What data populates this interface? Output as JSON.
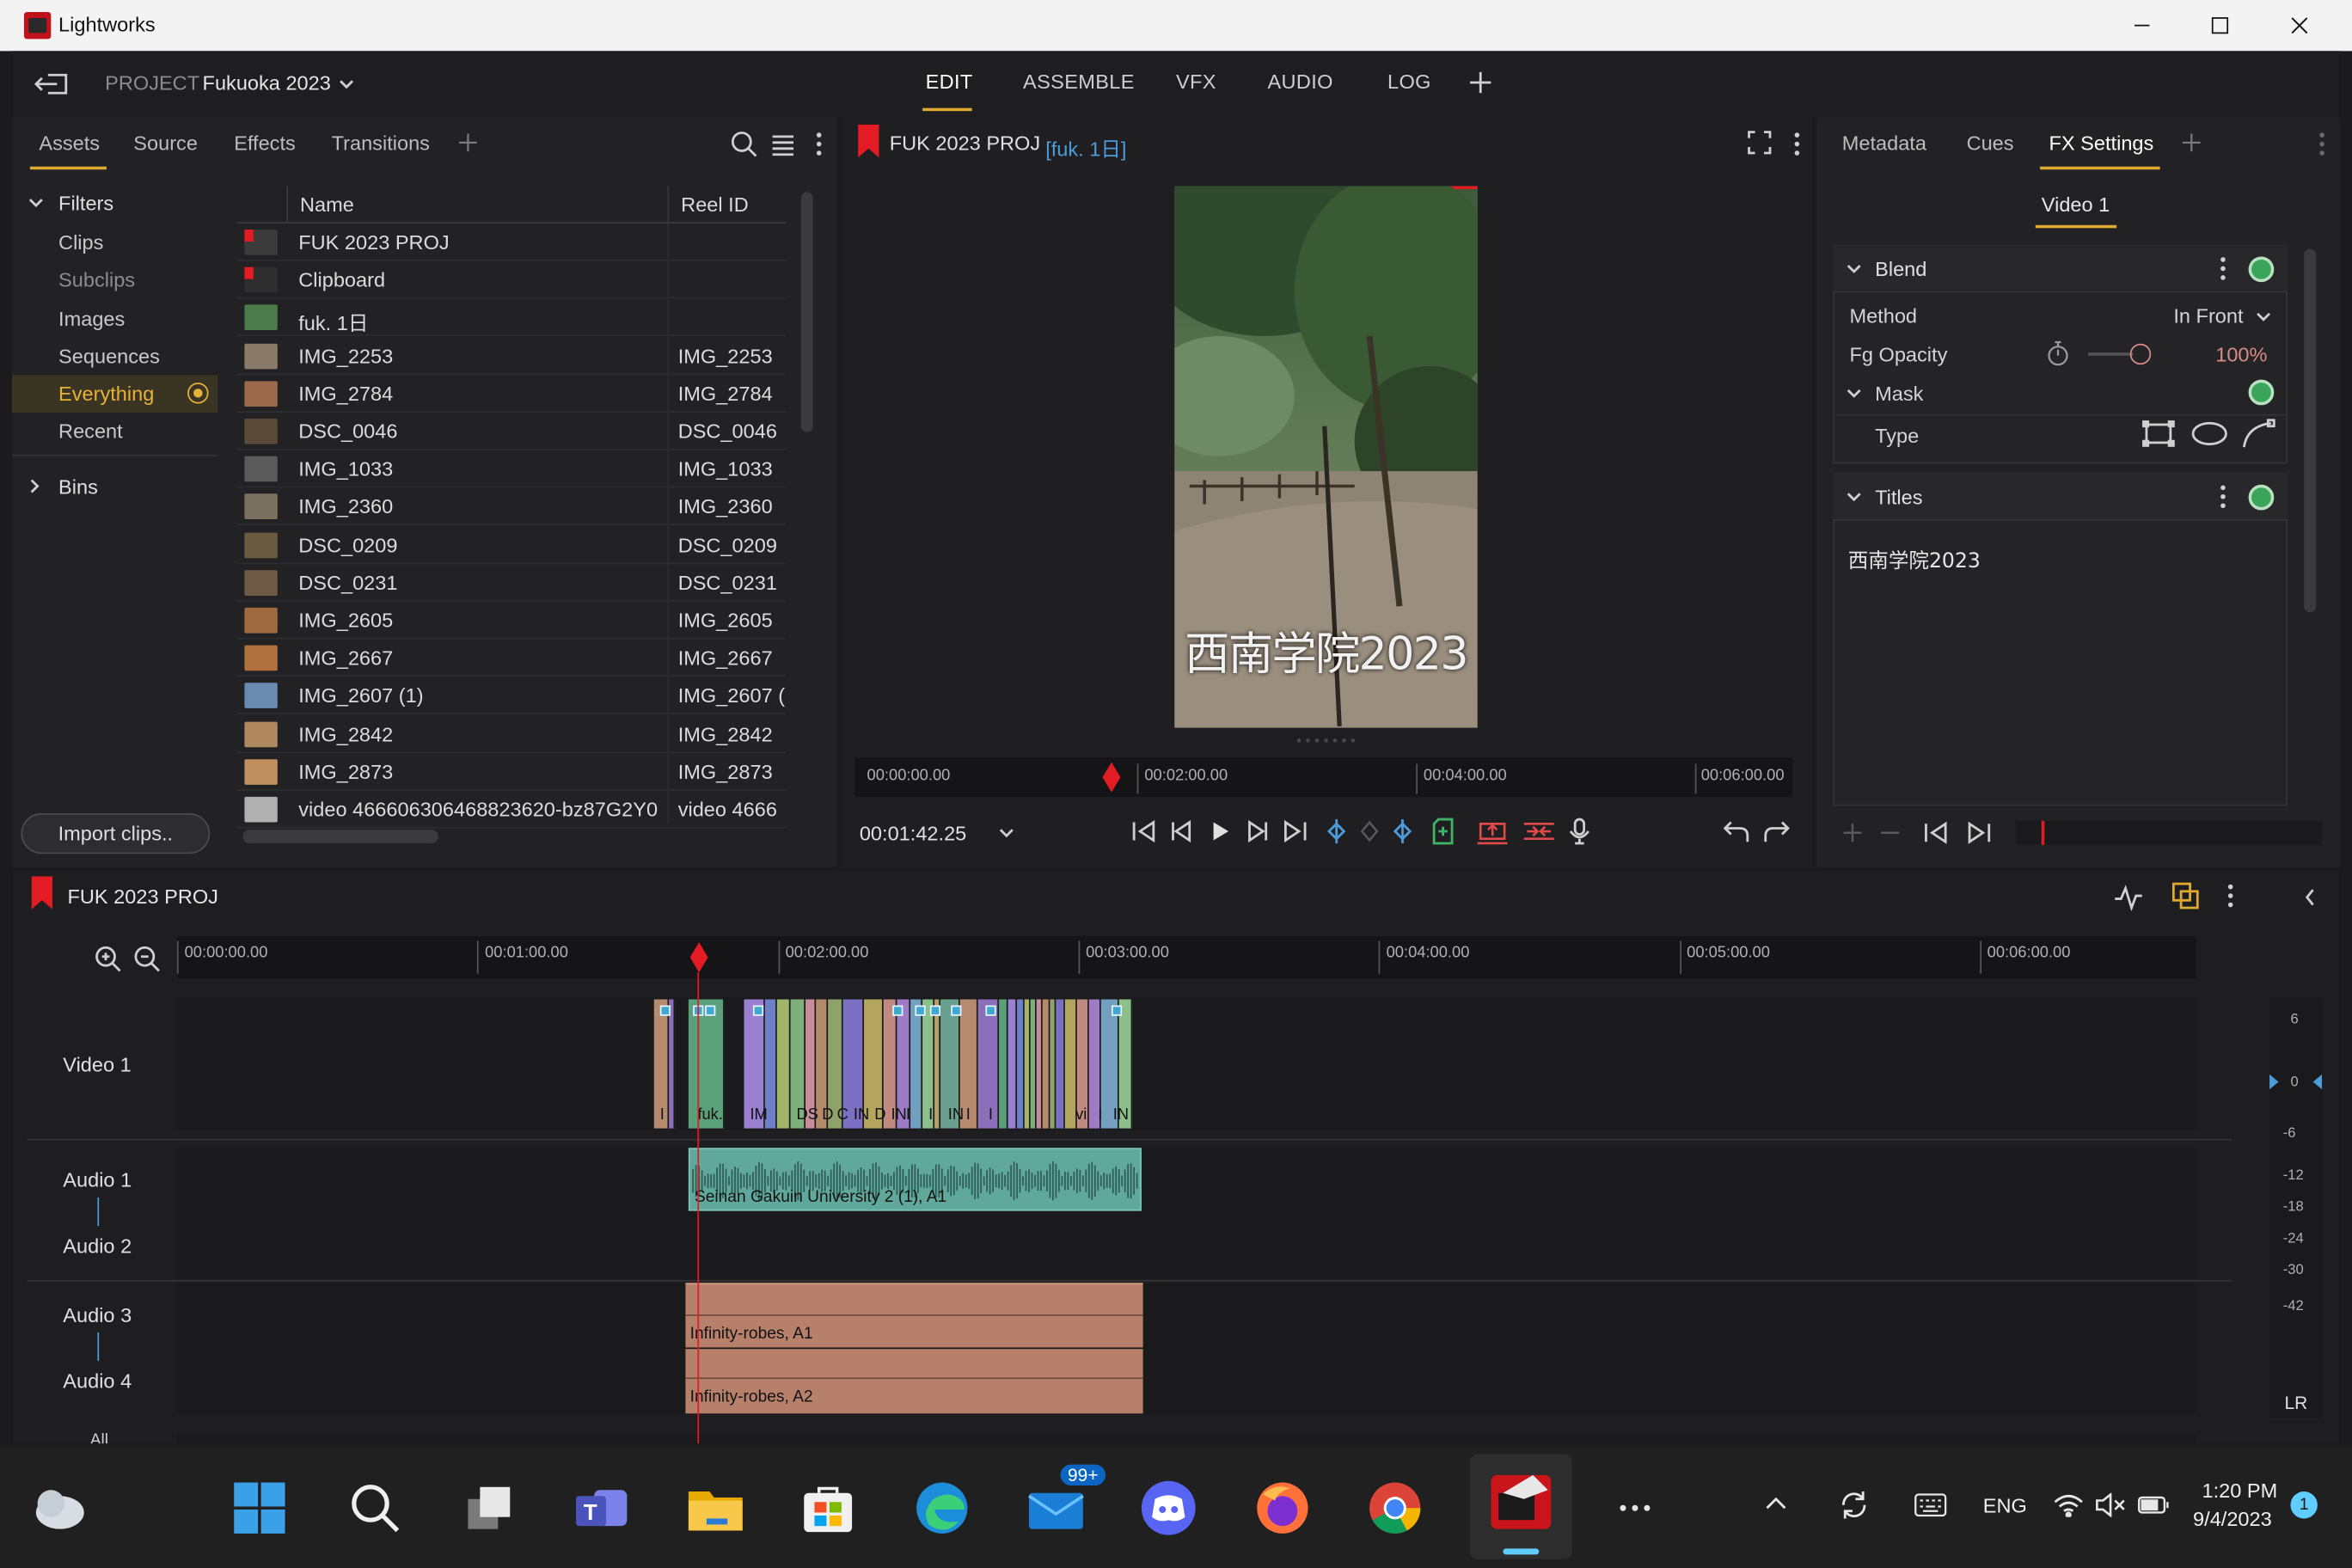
{
  "window": {
    "title": "Lightworks"
  },
  "topnav": {
    "project_prefix": "PROJECT",
    "project_name": "Fukuoka 2023",
    "tabs": [
      "EDIT",
      "ASSEMBLE",
      "VFX",
      "AUDIO",
      "LOG"
    ],
    "active_tab": "EDIT"
  },
  "assets_panel": {
    "tabs": [
      "Assets",
      "Source",
      "Effects",
      "Transitions"
    ],
    "active_tab": "Assets",
    "filters_header": "Filters",
    "filters": [
      "Clips",
      "Subclips",
      "Images",
      "Sequences",
      "Everything",
      "Recent"
    ],
    "active_filter": "Everything",
    "bins_header": "Bins",
    "import_button": "Import clips..",
    "columns": [
      "Name",
      "Reel ID"
    ],
    "rows": [
      {
        "name": "FUK 2023 PROJ",
        "reel": ""
      },
      {
        "name": "Clipboard",
        "reel": ""
      },
      {
        "name": "fuk. 1日",
        "reel": ""
      },
      {
        "name": "IMG_2253",
        "reel": "IMG_2253"
      },
      {
        "name": "IMG_2784",
        "reel": "IMG_2784"
      },
      {
        "name": "DSC_0046",
        "reel": "DSC_0046"
      },
      {
        "name": "IMG_1033",
        "reel": "IMG_1033"
      },
      {
        "name": "IMG_2360",
        "reel": "IMG_2360"
      },
      {
        "name": "DSC_0209",
        "reel": "DSC_0209"
      },
      {
        "name": "DSC_0231",
        "reel": "DSC_0231"
      },
      {
        "name": "IMG_2605",
        "reel": "IMG_2605"
      },
      {
        "name": "IMG_2667",
        "reel": "IMG_2667"
      },
      {
        "name": "IMG_2607 (1)",
        "reel": "IMG_2607 ("
      },
      {
        "name": "IMG_2842",
        "reel": "IMG_2842"
      },
      {
        "name": "IMG_2873",
        "reel": "IMG_2873"
      },
      {
        "name": "video 466606306468823620-bz87G2Y0",
        "reel": "video 4666"
      }
    ]
  },
  "viewer": {
    "title": "FUK 2023 PROJ",
    "subtitle": "[fuk. 1日]",
    "overlay_text": "西南学院2023",
    "ruler": [
      "00:00:00.00",
      "00:02:00.00",
      "00:04:00.00",
      "00:06:00.00"
    ],
    "timecode": "00:01:42.25",
    "playhead_fraction": 0.284
  },
  "fx_panel": {
    "tabs": [
      "Metadata",
      "Cues",
      "FX Settings"
    ],
    "active_tab": "FX Settings",
    "subtab": "Video 1",
    "blend_label": "Blend",
    "method_label": "Method",
    "method_value": "In Front",
    "opacity_label": "Fg Opacity",
    "opacity_value": "100%",
    "mask_label": "Mask",
    "type_label": "Type",
    "titles_label": "Titles",
    "titles_text": "西南学院2023"
  },
  "timeline": {
    "title": "FUK 2023 PROJ",
    "ruler": [
      "00:00:00.00",
      "00:01:00.00",
      "00:02:00.00",
      "00:03:00.00",
      "00:04:00.00",
      "00:05:00.00",
      "00:06:00.00"
    ],
    "tracks": {
      "video1": "Video 1",
      "audio1": "Audio 1",
      "audio2": "Audio 2",
      "audio3": "Audio 3",
      "audio4": "Audio 4",
      "all": "All"
    },
    "audio12_clip": "Seinan Gakuin University 2 (1), A1",
    "audio3_clip": "Infinity-robes, A1",
    "audio4_clip": "Infinity-robes, A2",
    "video_clip_labels": [
      "I",
      "fuk.",
      "IM",
      "DS",
      "D",
      "C",
      "IN",
      "D",
      "IN",
      "I",
      "I",
      "IN",
      "I",
      "I",
      "vi",
      "I",
      "IN"
    ],
    "meter_scale": [
      "6",
      "0",
      "-6",
      "-12",
      "-18",
      "-24",
      "-30",
      "-42"
    ],
    "meter_lr": "LR"
  },
  "taskbar": {
    "mail_badge": "99+",
    "language": "ENG",
    "time": "1:20 PM",
    "date": "9/4/2023",
    "notification_count": "1"
  },
  "colors": {
    "accent": "#e0a930",
    "playhead": "#e31b23",
    "audio_teal": "#5fa89b",
    "audio_salmon": "#b7806a"
  }
}
